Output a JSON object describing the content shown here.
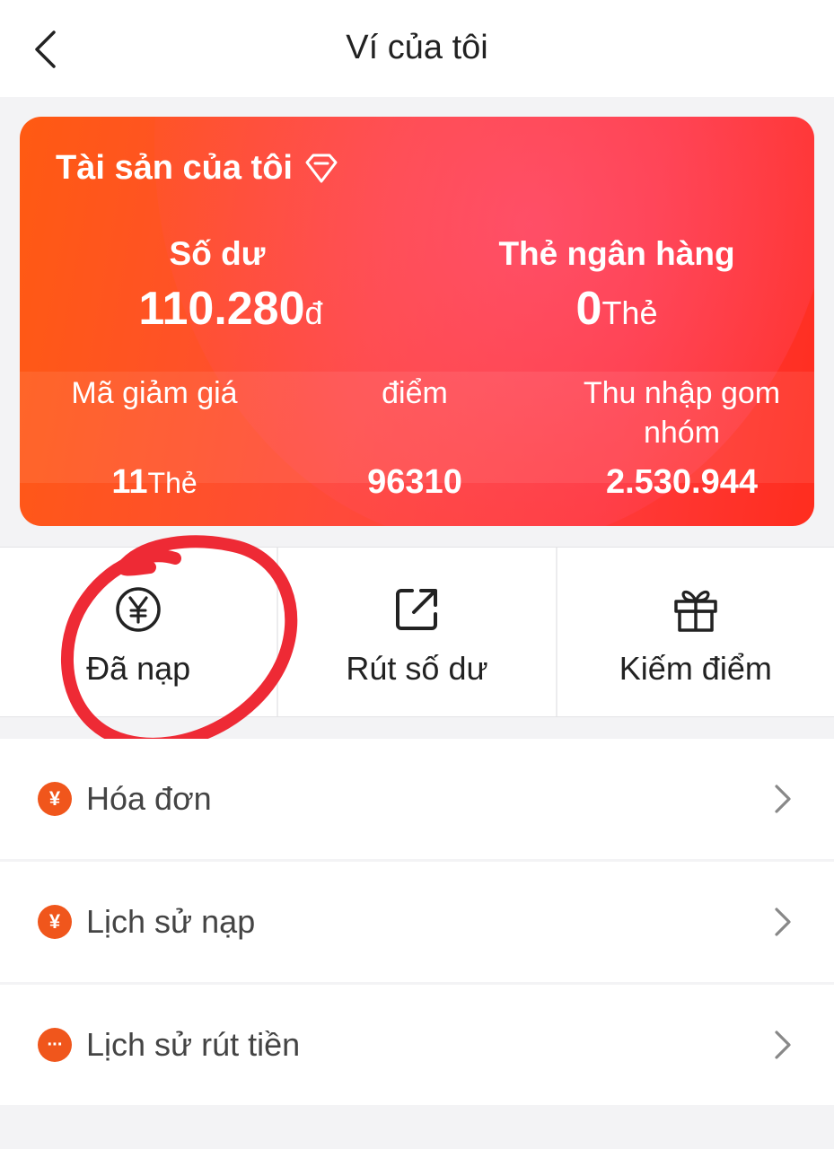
{
  "header": {
    "title": "Ví của tôi",
    "back_icon": "chevron-left-icon"
  },
  "assets": {
    "title": "Tài sản của tôi",
    "title_icon": "diamond-icon",
    "balance": {
      "label": "Số dư",
      "value": "110.280",
      "unit": "đ"
    },
    "bank_cards": {
      "label": "Thẻ ngân hàng",
      "value": "0",
      "unit": "Thẻ"
    },
    "vouchers": {
      "label": "Mã giảm giá",
      "value": "11",
      "unit": "Thẻ"
    },
    "points": {
      "label": "điểm",
      "value": "96310"
    },
    "group_income": {
      "label": "Thu nhập gom nhóm",
      "value": "2.530.944"
    }
  },
  "actions": [
    {
      "label": "Đã nạp",
      "icon": "yen-circle-icon"
    },
    {
      "label": "Rút số dư",
      "icon": "external-link-icon"
    },
    {
      "label": "Kiếm điểm",
      "icon": "gift-icon"
    }
  ],
  "menu": [
    {
      "label": "Hóa đơn",
      "icon": "yen-badge-icon",
      "glyph": "¥"
    },
    {
      "label": "Lịch sử nạp",
      "icon": "yen-badge-icon",
      "glyph": "¥"
    },
    {
      "label": "Lịch sử rút tiền",
      "icon": "more-dots-icon",
      "glyph": "···"
    }
  ],
  "colors": {
    "accent": "#f0561c",
    "card_start": "#ff5a12",
    "card_end": "#ff2d1e",
    "annotation": "#ee2a35"
  }
}
